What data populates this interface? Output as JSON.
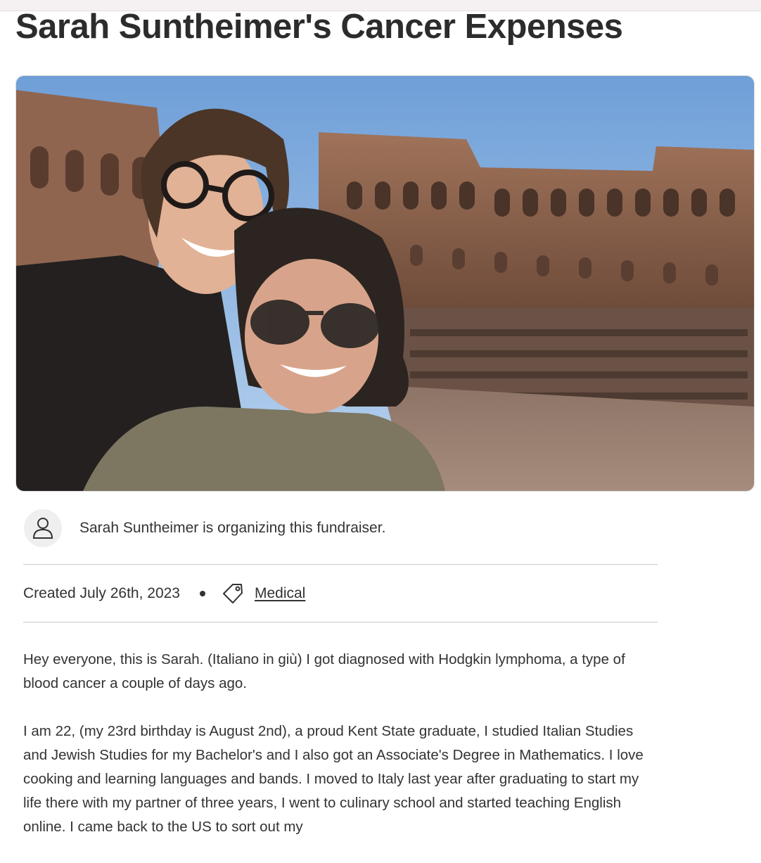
{
  "page": {
    "title": "Sarah Suntheimer's Cancer Expenses"
  },
  "organizer": {
    "icon": "user-icon",
    "text": "Sarah Suntheimer is organizing this fundraiser."
  },
  "meta": {
    "created": "Created July 26th, 2023",
    "category_icon": "tag-icon",
    "category": "Medical"
  },
  "story": {
    "paragraphs": [
      "Hey everyone, this is Sarah. (Italiano in giù) I got diagnosed with Hodgkin lymphoma, a type of blood cancer a couple of days ago.",
      "I am 22, (my 23rd birthday is August 2nd), a proud Kent State graduate, I studied Italian Studies and Jewish Studies for my Bachelor's and I also got an Associate's Degree in Mathematics. I love cooking and learning languages and bands. I moved to Italy last year after graduating to start my life there with my partner of three years, I went to culinary school and started teaching English online. I came back to the US to sort out my"
    ]
  },
  "colors": {
    "text": "#333333",
    "divider": "#c9c9c9",
    "avatar_bg": "#efefef"
  }
}
